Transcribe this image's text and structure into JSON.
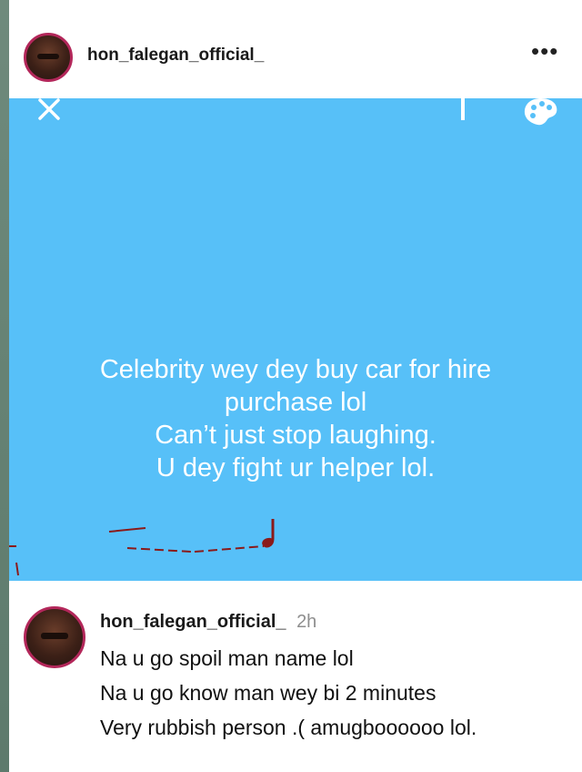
{
  "header": {
    "username": "hon_falegan_official_",
    "more_label": "•••",
    "avatar_icon": "profile-avatar"
  },
  "story": {
    "background_color": "#57c0f8",
    "lines": [
      "Celebrity wey dey buy car for hire",
      "purchase lol",
      "Can’t just stop laughing.",
      "U dey fight ur helper lol."
    ],
    "icons": [
      "close-icon",
      "text-tool-icon",
      "palette-icon"
    ]
  },
  "comment": {
    "username": "hon_falegan_official_",
    "time": "2h",
    "lines": [
      "Na u go spoil man name lol",
      "Na u go know man wey bi 2 minutes",
      "Very rubbish person .( amugboooooo lol."
    ]
  }
}
